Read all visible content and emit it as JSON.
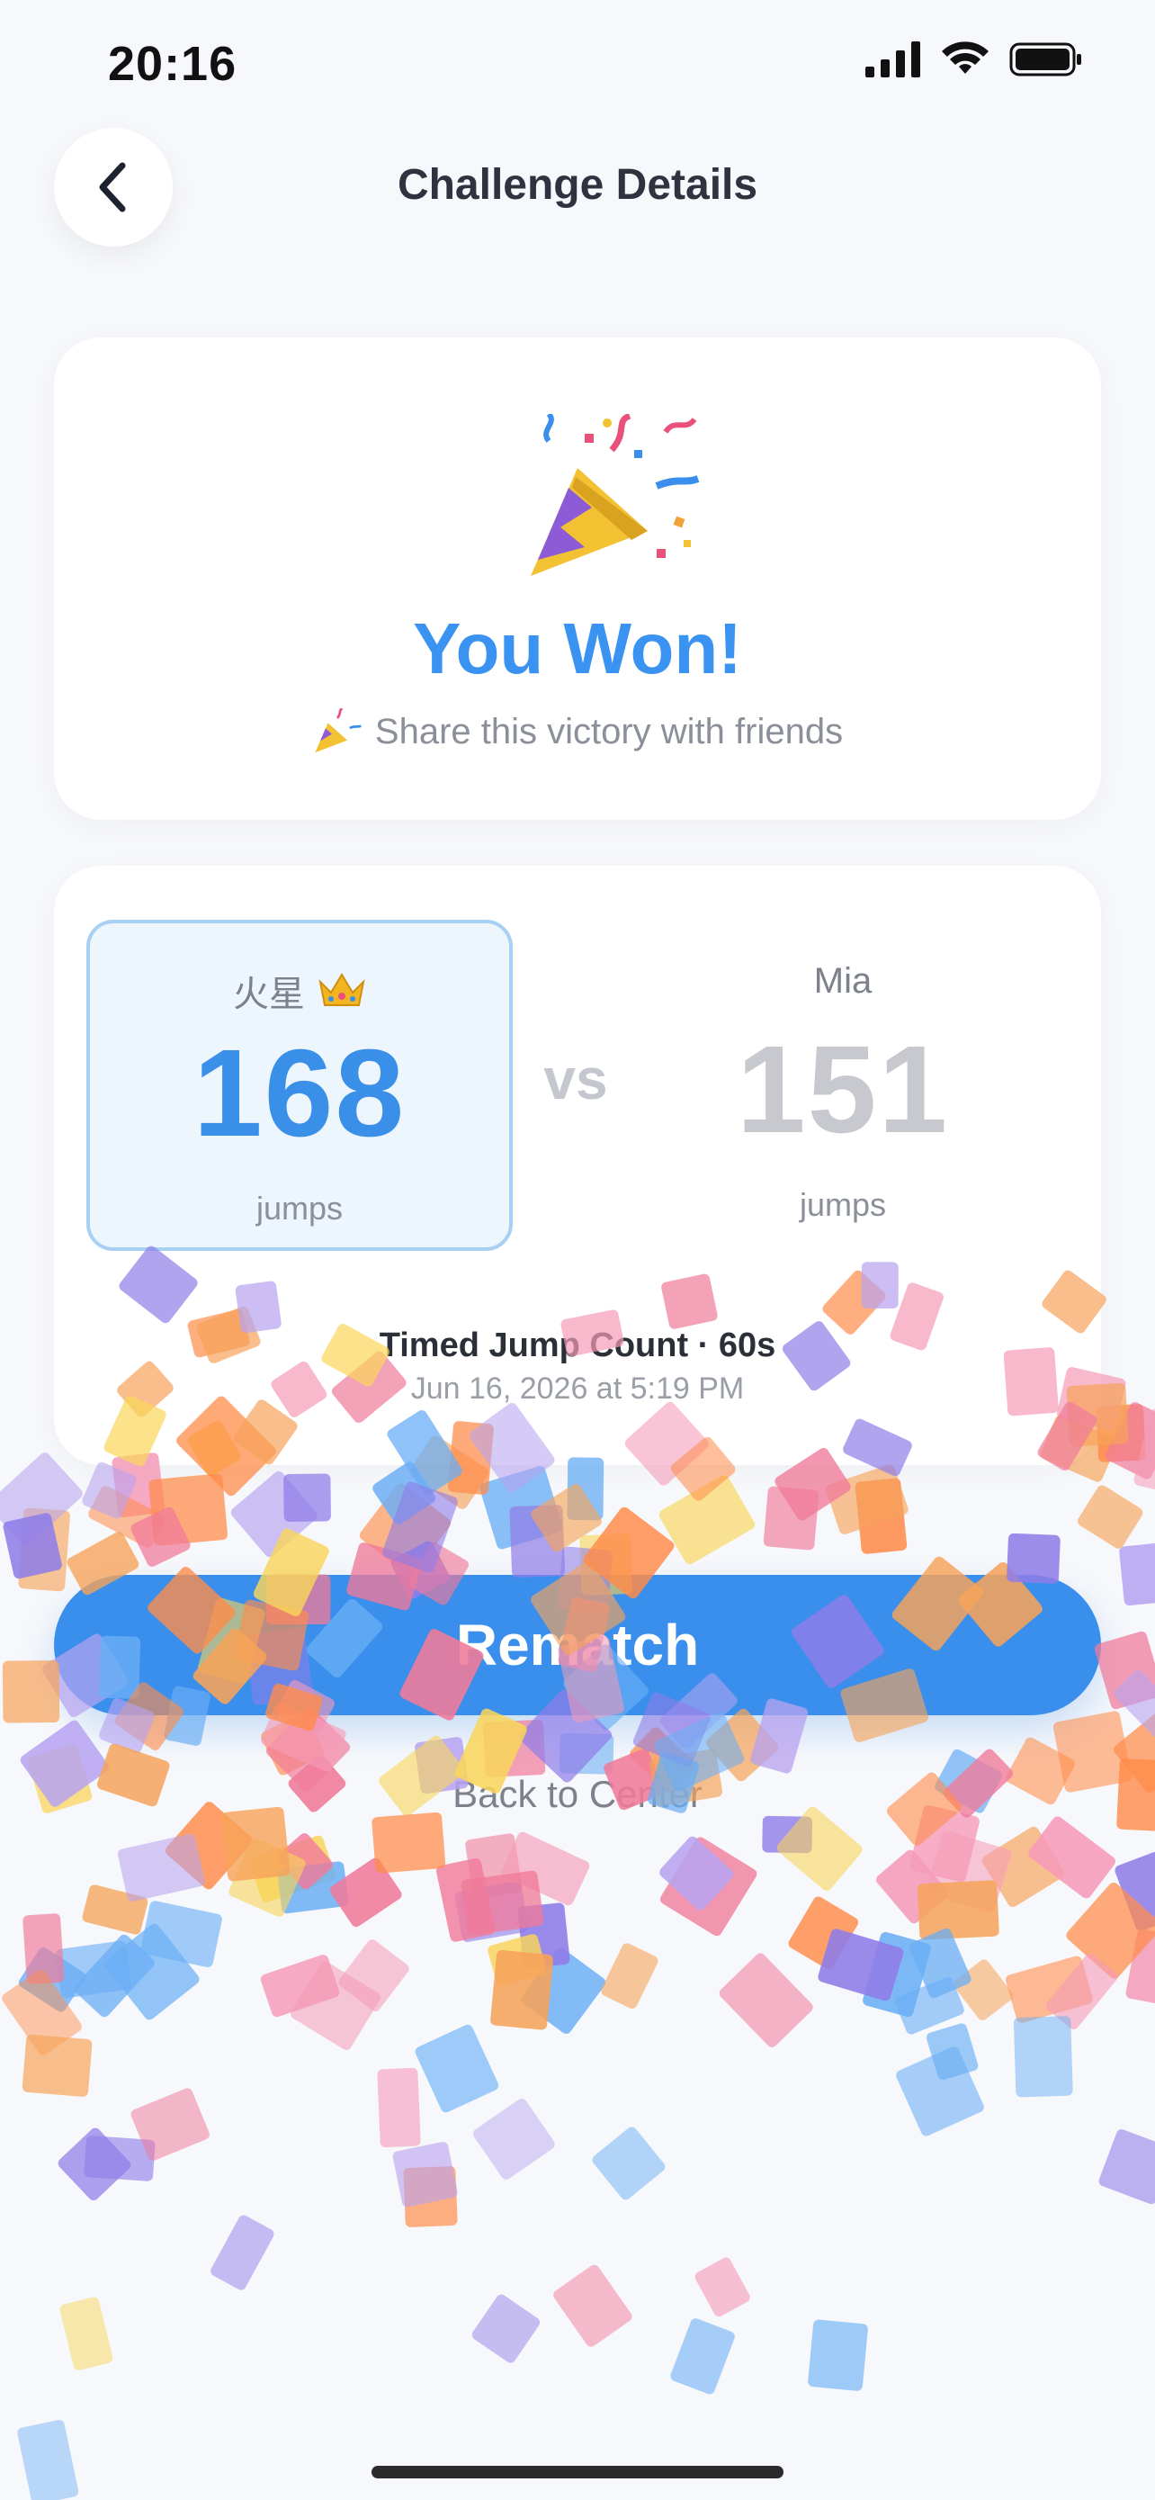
{
  "status_bar": {
    "time": "20:16"
  },
  "nav": {
    "title": "Challenge Details"
  },
  "result": {
    "title": "You Won!",
    "share_text": "Share this victory with friends"
  },
  "match": {
    "player1": {
      "name": "火星",
      "score": "168",
      "unit": "jumps",
      "winner": true
    },
    "player2": {
      "name": "Mia",
      "score": "151",
      "unit": "jumps",
      "winner": false
    },
    "vs_label": "vs",
    "mode": "Timed Jump Count · 60s",
    "date": "Jun 16, 2026 at 5:19 PM"
  },
  "actions": {
    "rematch_label": "Rematch",
    "back_center_label": "Back to Center"
  },
  "colors": {
    "accent": "#3a8fed",
    "win_text": "#3a93f0",
    "lose_score": "#c7c9ce",
    "background": "#f7f8fb"
  },
  "icons": {
    "back": "chevron-left-icon",
    "celebration": "party-popper-icon",
    "winner": "crown-icon"
  }
}
